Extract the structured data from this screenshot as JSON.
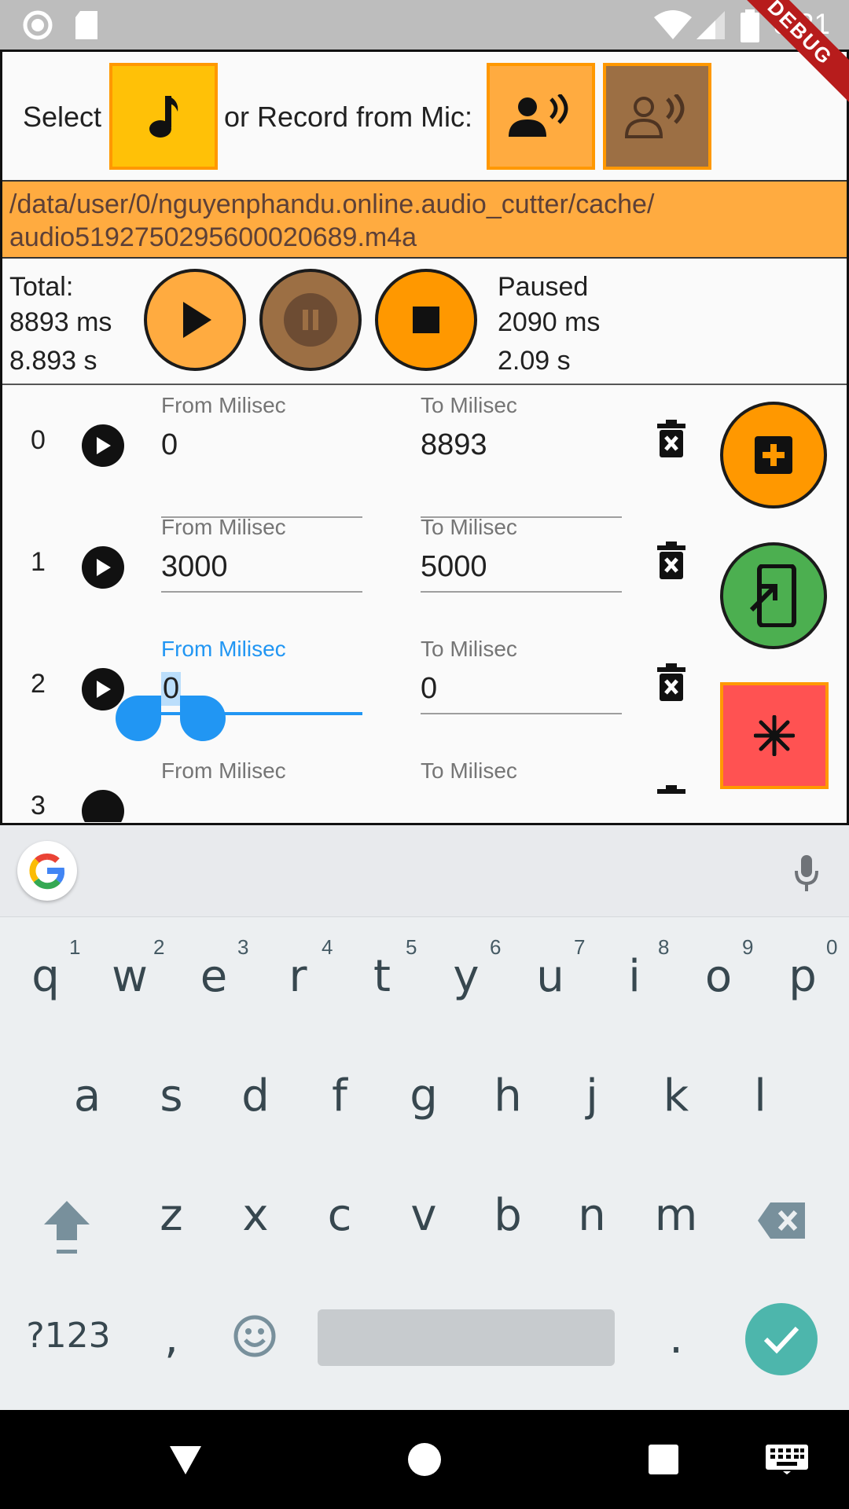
{
  "status_bar": {
    "time": "8:21",
    "debug_label": "DEBUG"
  },
  "header": {
    "select_label": "Select",
    "record_label": "or Record from Mic:"
  },
  "path": {
    "line1": "/data/user/0/nguyenphandu.online.audio_cutter/cache/",
    "line2": "audio5192750295600020689.m4a"
  },
  "player": {
    "total_label": "Total:",
    "total_ms": "8893 ms",
    "total_s": "8.893 s",
    "state_label": "Paused",
    "pos_ms": "2090 ms",
    "pos_s": "2.09 s"
  },
  "segments": [
    {
      "index": "0",
      "from_label": "From Milisec",
      "from_value": "0",
      "to_label": "To Milisec",
      "to_value": "8893"
    },
    {
      "index": "1",
      "from_label": "From Milisec",
      "from_value": "3000",
      "to_label": "To Milisec",
      "to_value": "5000"
    },
    {
      "index": "2",
      "from_label": "From Milisec",
      "from_value": "0",
      "to_label": "To Milisec",
      "to_value": "0"
    },
    {
      "index": "3",
      "from_label": "From Milisec",
      "to_label": "To Milisec"
    }
  ],
  "keyboard": {
    "row1": [
      "q",
      "w",
      "e",
      "r",
      "t",
      "y",
      "u",
      "i",
      "o",
      "p"
    ],
    "hints": [
      "1",
      "2",
      "3",
      "4",
      "5",
      "6",
      "7",
      "8",
      "9",
      "0"
    ],
    "row2": [
      "a",
      "s",
      "d",
      "f",
      "g",
      "h",
      "j",
      "k",
      "l"
    ],
    "row3": [
      "z",
      "x",
      "c",
      "v",
      "b",
      "n",
      "m"
    ],
    "symbols_key": "?123",
    "comma_key": ",",
    "period_key": "."
  },
  "colors": {
    "accent_orange": "#ff9800",
    "light_orange": "#ffab40",
    "brown": "#9c6f44",
    "green": "#4caf50",
    "red": "#ff5252",
    "focus_blue": "#2196f3",
    "enter_teal": "#4db6ac"
  },
  "icons": {
    "music": "music-note-icon",
    "record": "record-voice-icon",
    "stop_record": "voice-off-icon",
    "play": "play-icon",
    "pause": "pause-icon",
    "stop": "stop-icon",
    "delete": "delete-forever-icon",
    "add": "add-box-icon",
    "export": "export-icon",
    "snowflake": "snowflake-icon"
  }
}
